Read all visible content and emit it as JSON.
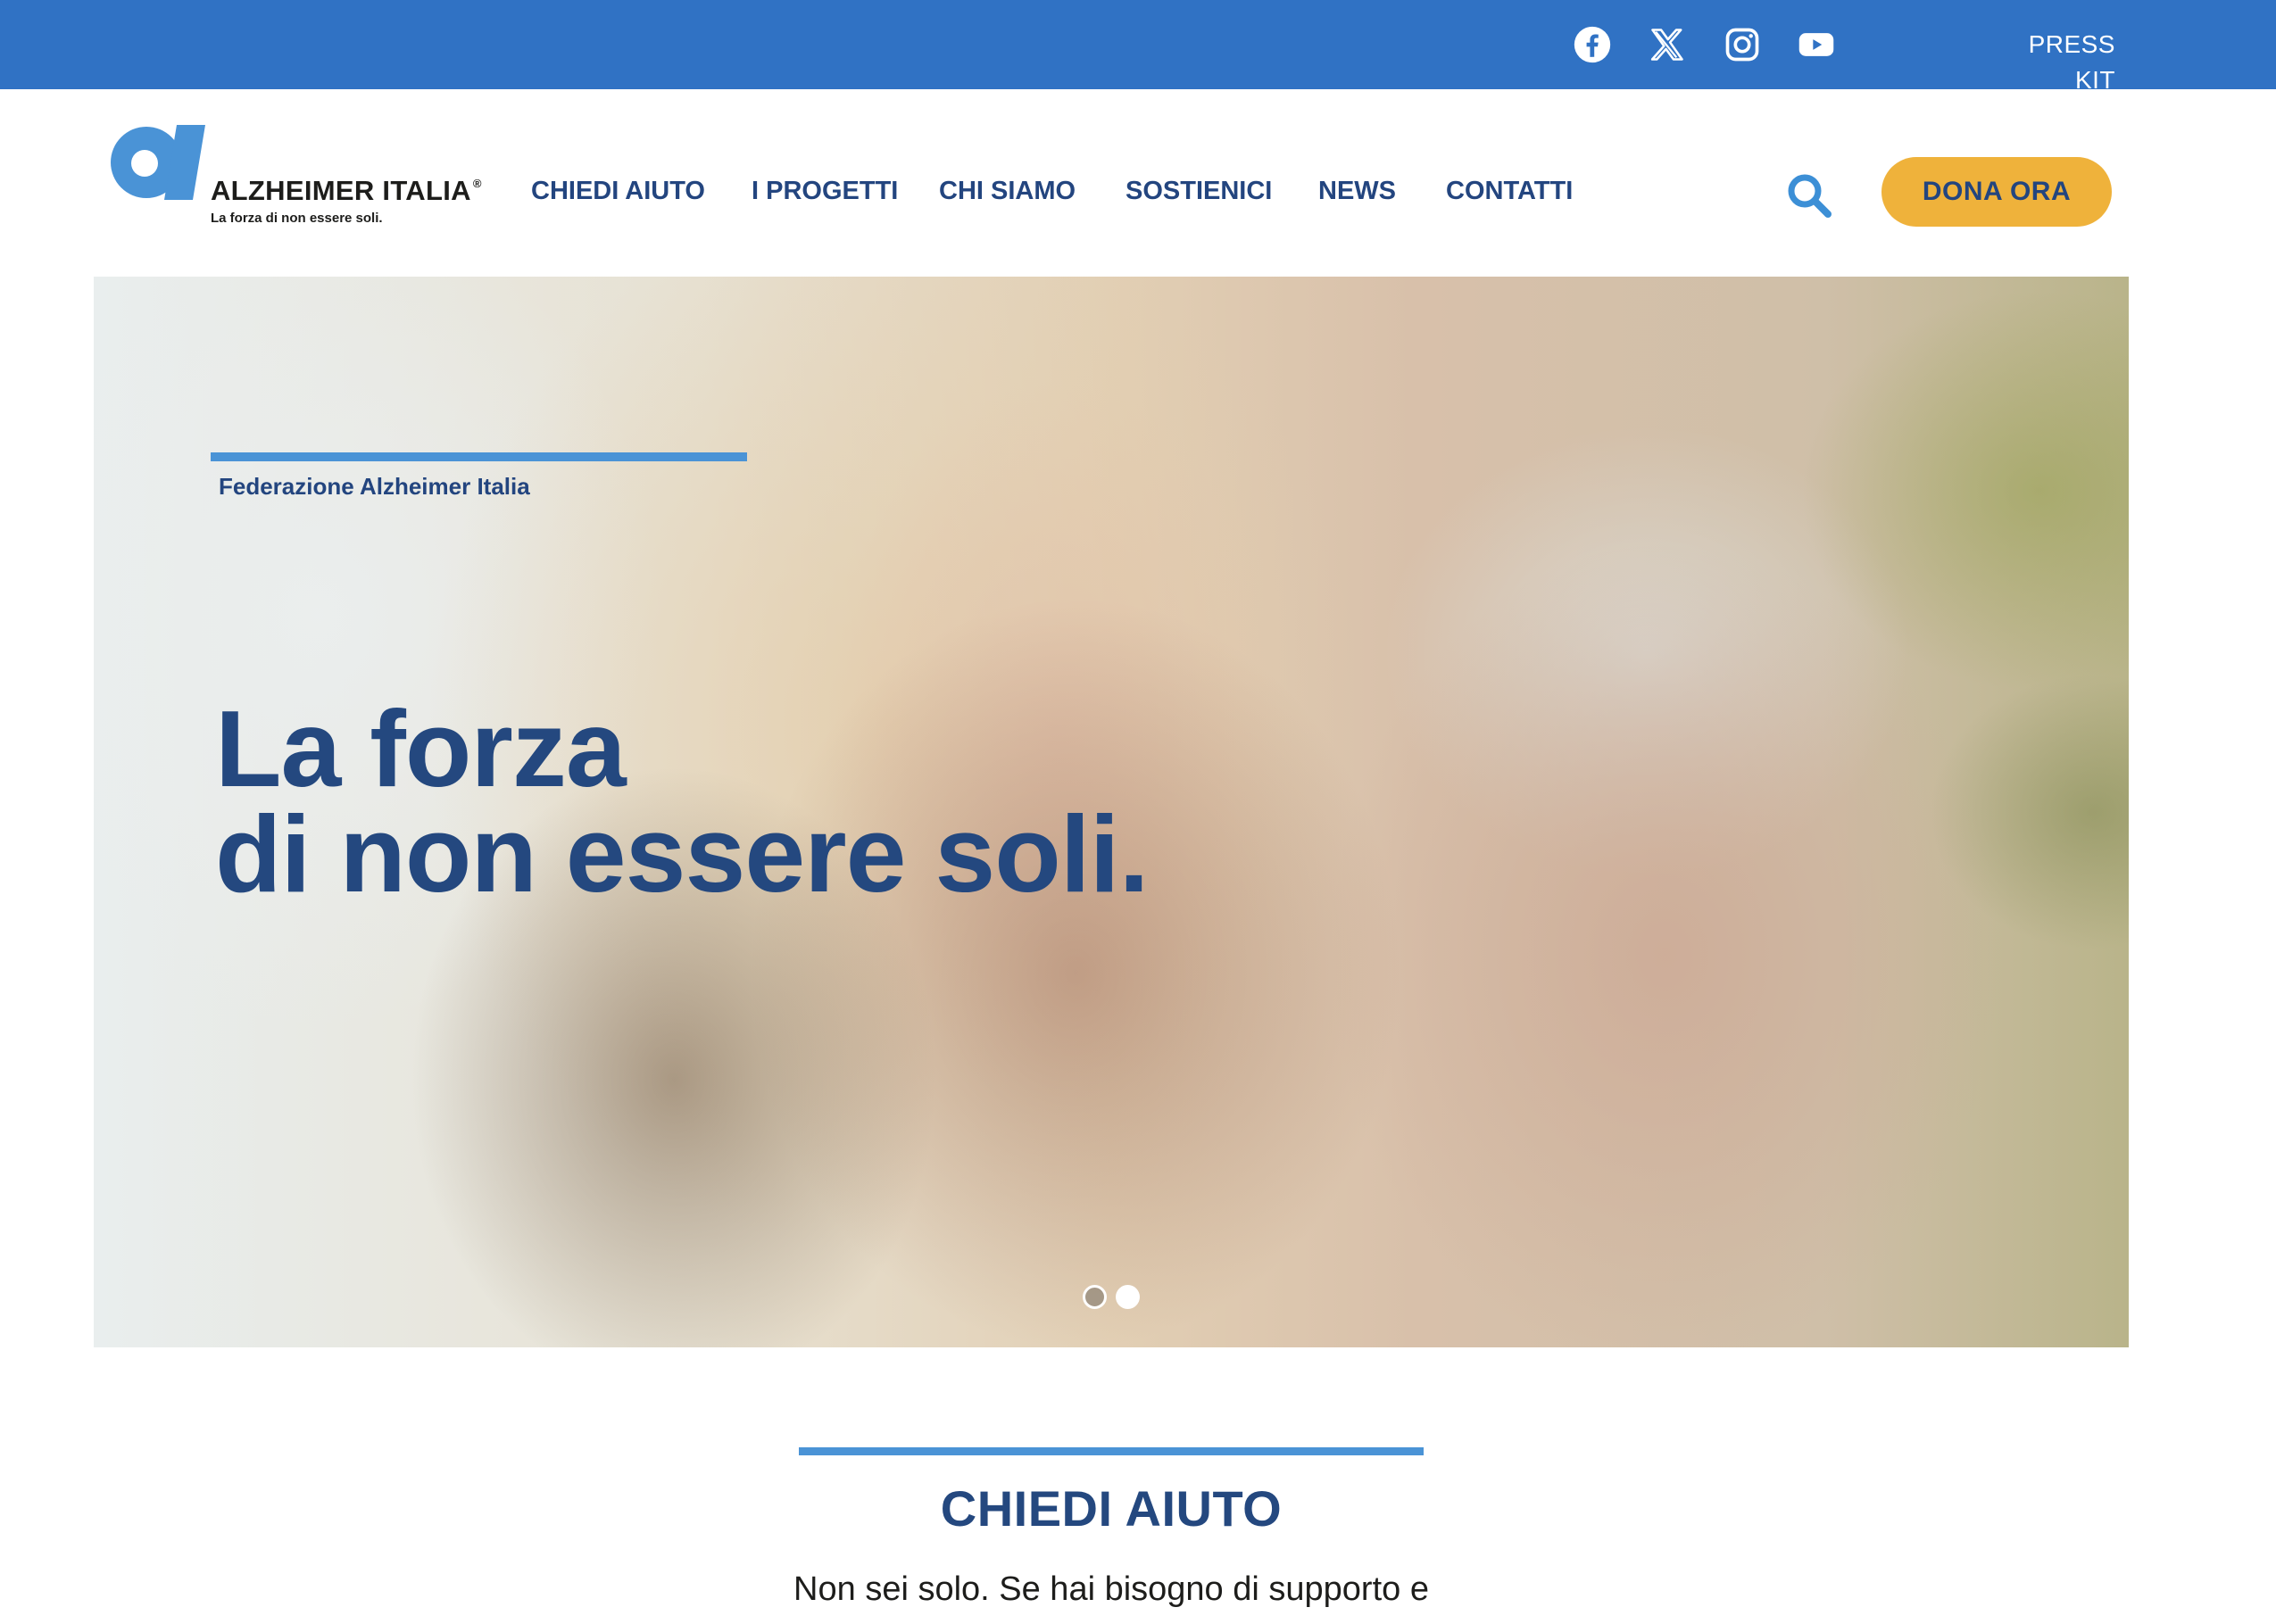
{
  "topbar": {
    "social": [
      {
        "icon": "facebook-icon"
      },
      {
        "icon": "x-icon"
      },
      {
        "icon": "instagram-icon"
      },
      {
        "icon": "youtube-icon"
      }
    ],
    "press_kit": "PRESS KIT",
    "bg_color": "#3072c4"
  },
  "logo": {
    "name": "ALZHEIMER ITALIA",
    "registered": "®",
    "tagline": "La forza di non essere soli."
  },
  "nav": {
    "items": [
      {
        "label": "CHIEDI AIUTO"
      },
      {
        "label": "I PROGETTI"
      },
      {
        "label": "CHI SIAMO"
      },
      {
        "label": "SOSTIENICI"
      },
      {
        "label": "NEWS"
      },
      {
        "label": "CONTATTI"
      }
    ],
    "search_icon": "search-icon",
    "donate_label": "DONA ORA",
    "donate_color": "#efb23b"
  },
  "hero": {
    "eyebrow": "Federazione Alzheimer Italia",
    "title_line1": "La forza",
    "title_line2": "di non essere soli.",
    "slides": [
      {
        "active": false
      },
      {
        "active": true
      }
    ]
  },
  "section": {
    "title": "CHIEDI AIUTO",
    "text": "Non sei solo. Se hai bisogno di supporto e"
  },
  "colors": {
    "primary_text": "#24487f",
    "accent_blue": "#4a93d6"
  }
}
